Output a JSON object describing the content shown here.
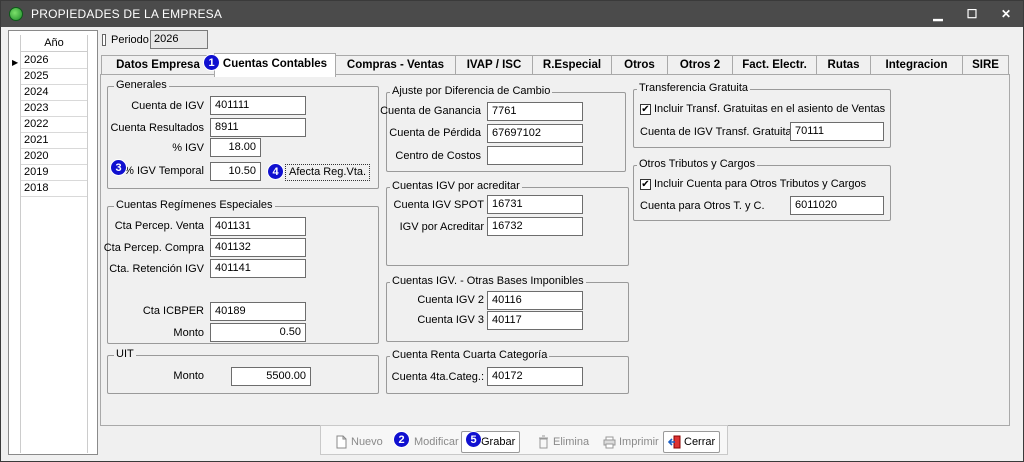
{
  "window": {
    "title": "PROPIEDADES DE LA EMPRESA",
    "minimize": "▁",
    "maximize": "☐",
    "close": "✕"
  },
  "years": {
    "header": "Año",
    "items": [
      "2026",
      "2025",
      "2024",
      "2023",
      "2022",
      "2021",
      "2020",
      "2019",
      "2018"
    ],
    "selected": "2026"
  },
  "periodo": {
    "label": "Periodo",
    "value": "2026"
  },
  "tabs": [
    "Datos Empresa",
    "Cuentas Contables",
    "Compras - Ventas",
    "IVAP / ISC",
    "R.Especial",
    "Otros",
    "Otros 2",
    "Fact. Electr.",
    "Rutas",
    "Integracion",
    "SIRE"
  ],
  "active_tab": "Cuentas Contables",
  "generales": {
    "title": "Generales",
    "cuenta_igv_label": "Cuenta de IGV",
    "cuenta_igv": "401111",
    "cuenta_resultados_label": "Cuenta Resultados",
    "cuenta_resultados": "8911",
    "pct_igv_label": "% IGV",
    "pct_igv": "18.00",
    "pct_igv_temporal_label": "% IGV Temporal",
    "pct_igv_temporal": "10.50",
    "afecta_label": "Afecta Reg.Vta."
  },
  "especiales": {
    "title": "Cuentas Regímenes Especiales",
    "percep_venta_label": "Cta Percep. Venta",
    "percep_venta": "401131",
    "percep_compra_label": "Cta Percep. Compra",
    "percep_compra": "401132",
    "retencion_label": "Cta. Retención IGV",
    "retencion": "401141",
    "icbper_label": "Cta ICBPER",
    "icbper": "40189",
    "monto_label": "Monto",
    "monto": "0.50"
  },
  "uit": {
    "title": "UIT",
    "monto_label": "Monto",
    "monto": "5500.00"
  },
  "ajuste": {
    "title": "Ajuste por Diferencia de Cambio",
    "ganancia_label": "Cuenta de Ganancia",
    "ganancia": "7761",
    "perdida_label": "Cuenta de Pérdida",
    "perdida": "67697102",
    "costos_label": "Centro de Costos",
    "costos": ""
  },
  "igv_acreditar": {
    "title": "Cuentas IGV por acreditar",
    "spot_label": "Cuenta IGV SPOT",
    "spot": "16731",
    "acreditar_label": "IGV por Acreditar",
    "acreditar": "16732"
  },
  "otras_bases": {
    "title": "Cuentas IGV. - Otras Bases Imponibles",
    "igv2_label": "Cuenta IGV 2",
    "igv2": "40116",
    "igv3_label": "Cuenta IGV 3",
    "igv3": "40117"
  },
  "renta_cuarta": {
    "title": "Cuenta Renta Cuarta Categoría",
    "label": "Cuenta 4ta.Categ.:",
    "value": "40172"
  },
  "transferencia": {
    "title": "Transferencia Gratuita",
    "check_label": "Incluir Transf. Gratuitas en el asiento de Ventas",
    "checked": "✔",
    "cuenta_label": "Cuenta de IGV Transf. Gratuita",
    "cuenta": "70111"
  },
  "otros_tributos": {
    "title": "Otros Tributos y Cargos",
    "check_label": "Incluir Cuenta para Otros Tributos y Cargos",
    "checked": "✔",
    "cuenta_label": "Cuenta para Otros T. y C.",
    "cuenta": "6011020"
  },
  "toolbar": {
    "nuevo": "Nuevo",
    "modificar": "Modificar",
    "grabar": "Grabar",
    "elimina": "Elimina",
    "imprimir": "Imprimir",
    "cerrar": "Cerrar"
  },
  "badges": {
    "b1": "1",
    "b2": "2",
    "b3": "3",
    "b4": "4",
    "b5": "5"
  },
  "colors": {
    "titlebar": "#4b4b4b",
    "badge": "#1010d0",
    "window_bg": "#f0f0f0"
  }
}
